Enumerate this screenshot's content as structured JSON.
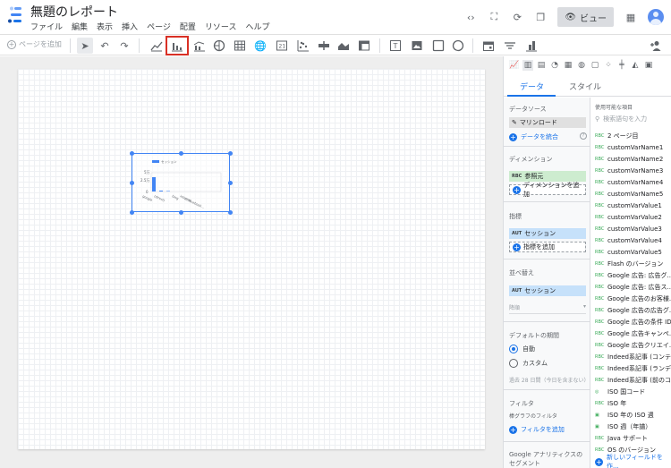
{
  "header": {
    "title": "無題のレポート",
    "menu": [
      "ファイル",
      "編集",
      "表示",
      "挿入",
      "ページ",
      "配置",
      "リソース",
      "ヘルプ"
    ],
    "view_label": "ビュー"
  },
  "toolbar": {
    "add_page": "ページを追加",
    "active_tool_icon": "bar-chart-icon",
    "active_tool_highlight": "#d93025"
  },
  "chart_preview": {
    "legend": "セッション",
    "y_ticks": [
      "5万",
      "2.5万",
      "0"
    ],
    "categories": [
      "google",
      "(direct)",
      "bing",
      "internal",
      "m.facebook..."
    ]
  },
  "panel": {
    "tab_data": "データ",
    "tab_style": "スタイル",
    "data_source_title": "データソース",
    "data_source_value": "マリンロード",
    "blend_label": "データを統合",
    "dimension_title": "ディメンション",
    "dimension_value": "参照元",
    "dimension_tag": "RBC",
    "add_dimension": "ディメンションを追加",
    "metric_title": "指標",
    "metric_value": "セッション",
    "metric_tag": "AUT",
    "add_metric": "指標を追加",
    "sort_title": "並べ替え",
    "sort_value": "セッション",
    "sort_order": "降順",
    "date_title": "デフォルトの期間",
    "date_auto": "自動",
    "date_custom": "カスタム",
    "date_note": "過去 28 日間（今日を含まない）",
    "filter_title": "フィルタ",
    "filter_sub": "棒グラフのフィルタ",
    "add_filter": "フィルタを追加",
    "segment_title": "Google アナリティクスのセグメント",
    "available_title": "使用可能な項目",
    "search_placeholder": "検索語句を入力",
    "new_field": "新しいフィールドを作...",
    "fields": [
      {
        "tag": "RBC",
        "name": "2 ページ目"
      },
      {
        "tag": "RBC",
        "name": "customVarName1"
      },
      {
        "tag": "RBC",
        "name": "customVarName2"
      },
      {
        "tag": "RBC",
        "name": "customVarName3"
      },
      {
        "tag": "RBC",
        "name": "customVarName4"
      },
      {
        "tag": "RBC",
        "name": "customVarName5"
      },
      {
        "tag": "RBC",
        "name": "customVarValue1"
      },
      {
        "tag": "RBC",
        "name": "customVarValue2"
      },
      {
        "tag": "RBC",
        "name": "customVarValue3"
      },
      {
        "tag": "RBC",
        "name": "customVarValue4"
      },
      {
        "tag": "RBC",
        "name": "customVarValue5"
      },
      {
        "tag": "RBC",
        "name": "Flash のバージョン"
      },
      {
        "tag": "RBC",
        "name": "Google 広告: 広告グ..."
      },
      {
        "tag": "RBC",
        "name": "Google 広告: 広告ス..."
      },
      {
        "tag": "RBC",
        "name": "Google 広告のお客様..."
      },
      {
        "tag": "RBC",
        "name": "Google 広告の広告グ..."
      },
      {
        "tag": "RBC",
        "name": "Google 広告の条件 ID"
      },
      {
        "tag": "RBC",
        "name": "Google 広告キャンペ..."
      },
      {
        "tag": "RBC",
        "name": "Google 広告クリエイ..."
      },
      {
        "tag": "RBC",
        "name": "Indeed系記事 (コンテ..."
      },
      {
        "tag": "RBC",
        "name": "Indeed系記事 (ランデ..."
      },
      {
        "tag": "RBC",
        "name": "Indeed系記事 (前のコ..."
      },
      {
        "tag": "◎",
        "name": "ISO 国コード"
      },
      {
        "tag": "RBC",
        "name": "ISO 年"
      },
      {
        "tag": "▣",
        "name": "ISO 年の ISO 週"
      },
      {
        "tag": "▣",
        "name": "ISO 週（年譜）"
      },
      {
        "tag": "RBC",
        "name": "Java サポート"
      },
      {
        "tag": "RBC",
        "name": "OS のバージョン"
      }
    ]
  },
  "colors": {
    "accent": "#1a73e8",
    "chart_bar": "#4285f4"
  }
}
